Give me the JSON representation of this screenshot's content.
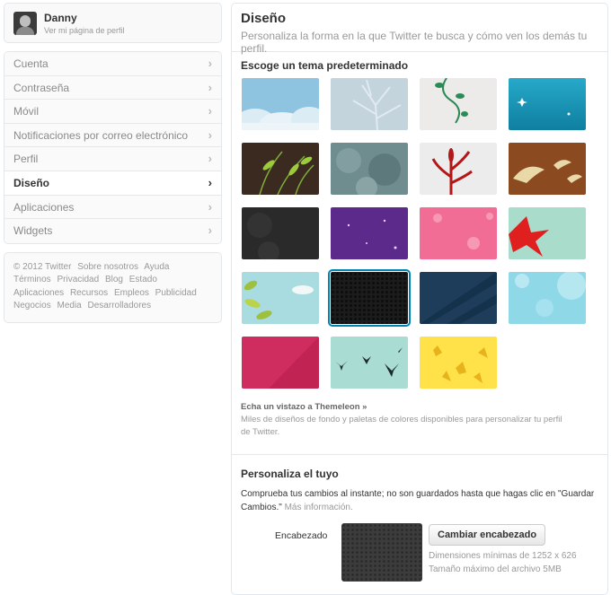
{
  "profile": {
    "name": "Danny",
    "link": "Ver mi página de perfil"
  },
  "menu": [
    {
      "label": "Cuenta",
      "active": false
    },
    {
      "label": "Contraseña",
      "active": false
    },
    {
      "label": "Móvil",
      "active": false
    },
    {
      "label": "Notificaciones por correo electrónico",
      "active": false
    },
    {
      "label": "Perfil",
      "active": false
    },
    {
      "label": "Diseño",
      "active": true
    },
    {
      "label": "Aplicaciones",
      "active": false
    },
    {
      "label": "Widgets",
      "active": false
    }
  ],
  "footer_links": [
    "© 2012 Twitter",
    "Sobre nosotros",
    "Ayuda",
    "Términos",
    "Privacidad",
    "Blog",
    "Estado",
    "Aplicaciones",
    "Recursos",
    "Empleos",
    "Publicidad",
    "Negocios",
    "Media",
    "Desarrolladores"
  ],
  "header": {
    "title": "Diseño",
    "subtitle": "Personaliza la forma en la que Twitter te busca y cómo ven los demás tu perfil."
  },
  "themes_title": "Escoge un tema predeterminado",
  "themes": [
    {
      "name": "clouds",
      "selected": false
    },
    {
      "name": "tree",
      "selected": false
    },
    {
      "name": "vine",
      "selected": false
    },
    {
      "name": "sparkle-teal",
      "selected": false
    },
    {
      "name": "green-leaves-dark",
      "selected": false
    },
    {
      "name": "gray-foliage",
      "selected": false
    },
    {
      "name": "red-plant",
      "selected": false
    },
    {
      "name": "brown-birds",
      "selected": false
    },
    {
      "name": "dark-gray",
      "selected": false
    },
    {
      "name": "purple-stars",
      "selected": false
    },
    {
      "name": "pink-flowers",
      "selected": false
    },
    {
      "name": "red-leaf-mint",
      "selected": false
    },
    {
      "name": "leaves-sky",
      "selected": false
    },
    {
      "name": "black-hex",
      "selected": true
    },
    {
      "name": "navy-rays",
      "selected": false
    },
    {
      "name": "light-blue-bokeh",
      "selected": false
    },
    {
      "name": "magenta",
      "selected": false
    },
    {
      "name": "birds-mint",
      "selected": false
    },
    {
      "name": "yellow-leaves",
      "selected": false
    }
  ],
  "themeleon": {
    "link": "Echa un vistazo a Themeleon »",
    "text": "Miles de diseños de fondo y paletas de colores disponibles para personalizar tu perfil de Twitter."
  },
  "customize": {
    "title": "Personaliza el tuyo",
    "text": "Comprueba tus cambios al instante; no son guardados hasta que hagas clic en \"Guardar Cambios.\"",
    "more": "Más información.",
    "header_label": "Encabezado",
    "button": "Cambiar encabezado",
    "dims": "Dimensiones mínimas de 1252 x 626",
    "maxsize": "Tamaño máximo del archivo 5MB"
  },
  "colors": {
    "accent": "#0084b4"
  }
}
